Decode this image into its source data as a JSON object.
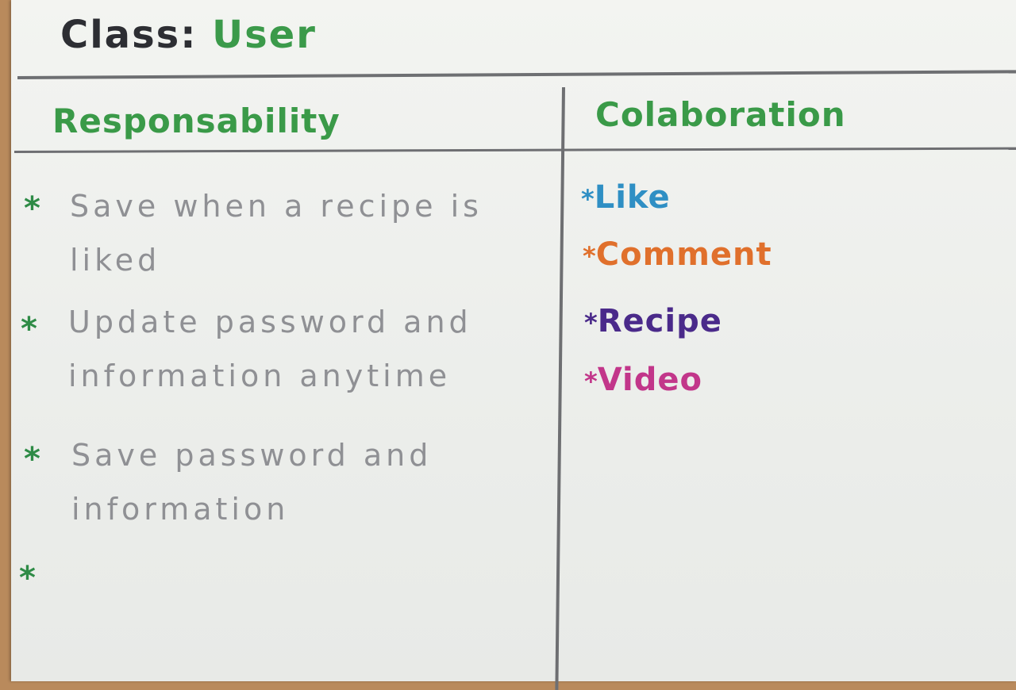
{
  "card": {
    "title_prefix": "Class:",
    "title_name": "User",
    "responsibility_header": "Responsability",
    "collaboration_header": "Colaboration"
  },
  "responsibilities": [
    {
      "bullet": "*",
      "text": "Save when a recipe is liked"
    },
    {
      "bullet": "*",
      "text": "Update password and information anytime"
    },
    {
      "bullet": "*",
      "text": "Save password and information"
    },
    {
      "bullet": "*",
      "text": ""
    }
  ],
  "collaborations": [
    {
      "bullet": "*",
      "text": "Like",
      "color": "#2f8fc4"
    },
    {
      "bullet": "*",
      "text": "Comment",
      "color": "#e0702c"
    },
    {
      "bullet": "*",
      "text": "Recipe",
      "color": "#4a2a8a"
    },
    {
      "bullet": "*",
      "text": "Video",
      "color": "#c2368a"
    }
  ]
}
